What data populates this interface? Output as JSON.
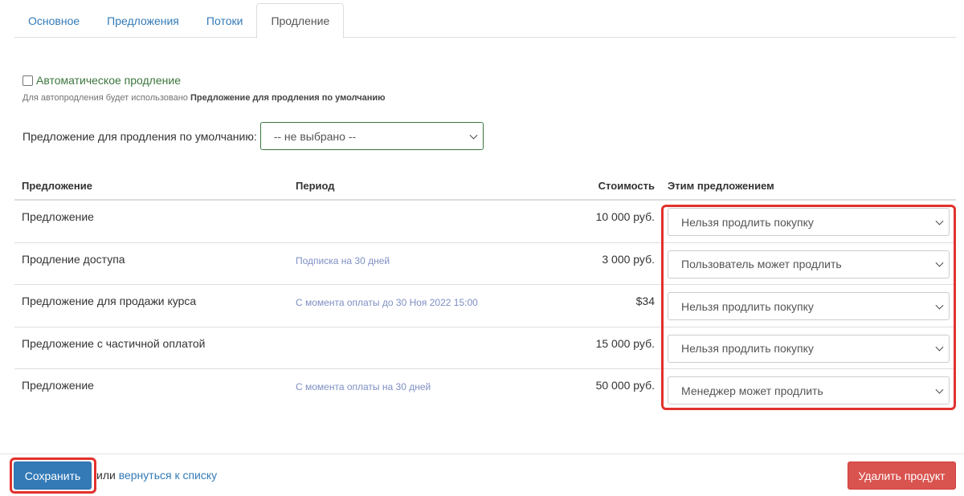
{
  "tabs": [
    {
      "label": "Основное"
    },
    {
      "label": "Предложения"
    },
    {
      "label": "Потоки"
    },
    {
      "label": "Продление"
    }
  ],
  "auto_renewal": {
    "checked": false,
    "label": "Автоматическое продление",
    "hint_prefix": "Для автопродления будет использовано",
    "hint_bold": "Предложение для продления по умолчанию"
  },
  "default_offer": {
    "label": "Предложение для продления по умолчанию:",
    "value": "-- не выбрано --"
  },
  "table": {
    "headers": {
      "offer": "Предложение",
      "period": "Период",
      "cost": "Стоимость",
      "action": "Этим предложением"
    },
    "rows": [
      {
        "name": "Предложение",
        "period": "",
        "cost": "10 000 руб.",
        "action": "Нельзя продлить покупку"
      },
      {
        "name": "Продление доступа",
        "period": "Подписка на 30 дней",
        "cost": "3 000 руб.",
        "action": "Пользователь может продлить"
      },
      {
        "name": "Предложение для продажи курса",
        "period": "С момента оплаты до 30 Ноя 2022 15:00",
        "cost": "$34",
        "action": "Нельзя продлить покупку"
      },
      {
        "name": "Предложение с частичной оплатой",
        "period": "",
        "cost": "15 000 руб.",
        "action": "Нельзя продлить покупку"
      },
      {
        "name": "Предложение",
        "period": "С момента оплаты на 30 дней",
        "cost": "50 000 руб.",
        "action": "Менеджер может продлить"
      }
    ]
  },
  "footer": {
    "save_label": "Сохранить",
    "or_text": "или",
    "back_link": "вернуться к списку",
    "delete_label": "Удалить продукт"
  },
  "colors": {
    "link": "#337ab7",
    "primary": "#337ab7",
    "danger": "#d9534f",
    "highlight": "#e2312d",
    "success_text": "#3c763d"
  }
}
